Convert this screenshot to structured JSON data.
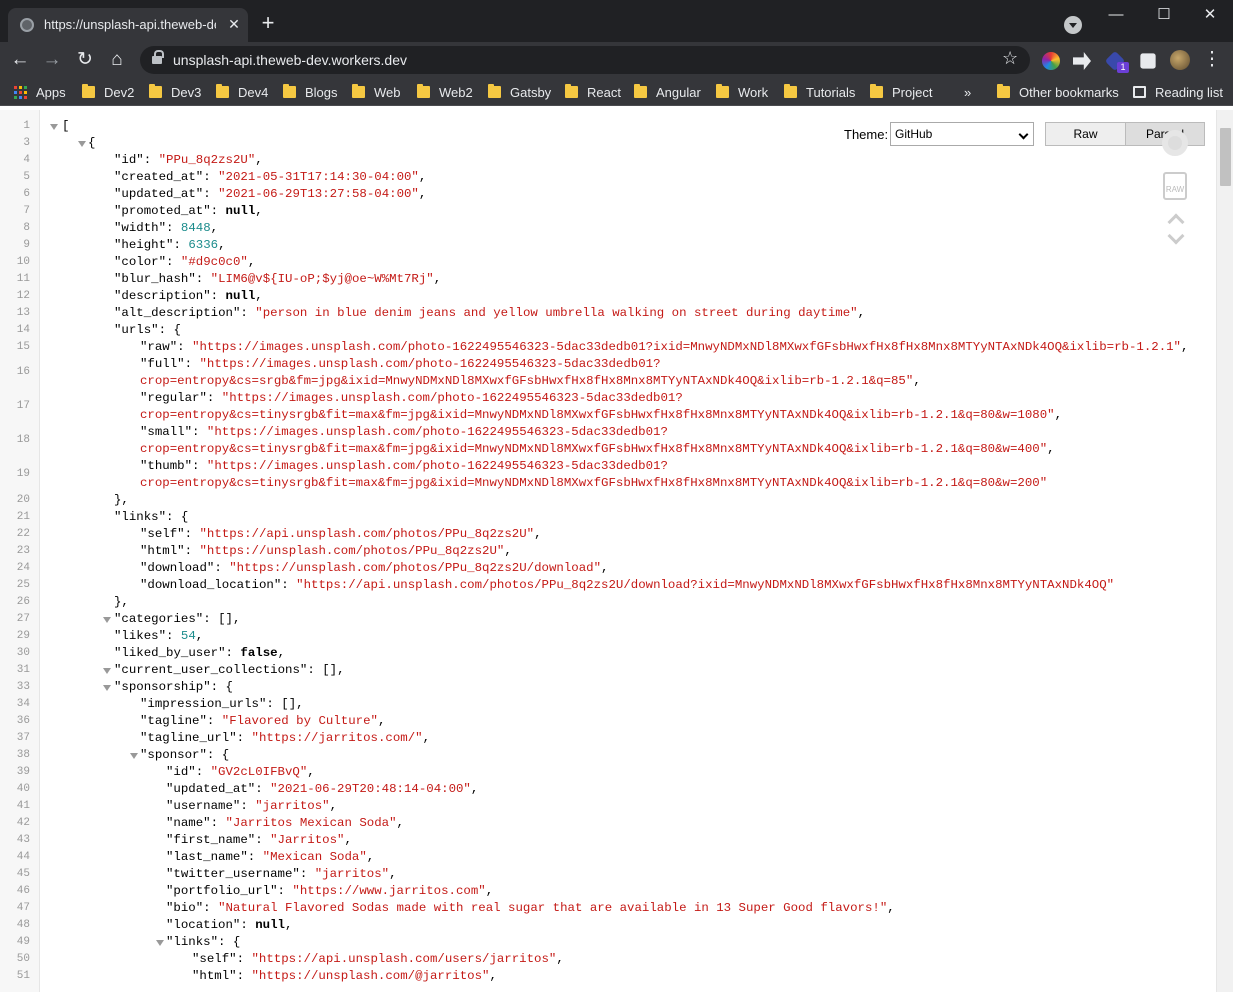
{
  "tab": {
    "title": "https://unsplash-api.theweb-dev.workers.dev",
    "close": "✕",
    "new_tab": "+"
  },
  "window": {
    "minimize": "—",
    "maximize": "☐",
    "close": "✕"
  },
  "toolbar": {
    "back": "←",
    "forward": "→",
    "reload": "↻",
    "home": "⌂",
    "star": "☆",
    "url": "unsplash-api.theweb-dev.workers.dev",
    "ext_badge": "1",
    "menu": "⋮"
  },
  "bookmarks": {
    "items": [
      "Apps",
      "Dev2",
      "Dev3",
      "Dev4",
      "Blogs",
      "Web",
      "Web2",
      "Gatsby",
      "React",
      "Angular",
      "Work",
      "Tutorials",
      "Project"
    ],
    "overflow": "»",
    "other": "Other bookmarks",
    "reading_list": "Reading list"
  },
  "viewer": {
    "theme_label": "Theme:",
    "theme_value": "GitHub",
    "raw_button": "Raw",
    "parsed_button": "Parsed",
    "raw_icon_label": "RAW"
  },
  "json_lines": [
    {
      "n": 1,
      "i": 0,
      "c": 1,
      "p": [
        [
          "k",
          "["
        ]
      ]
    },
    {
      "n": 3,
      "i": 1,
      "c": 1,
      "p": [
        [
          "k",
          "{"
        ]
      ]
    },
    {
      "n": 4,
      "i": 2,
      "p": [
        [
          "k",
          "\"id\": "
        ],
        [
          "s",
          "\"PPu_8q2zs2U\""
        ],
        [
          "k",
          ","
        ]
      ]
    },
    {
      "n": 5,
      "i": 2,
      "p": [
        [
          "k",
          "\"created_at\": "
        ],
        [
          "s",
          "\"2021-05-31T17:14:30-04:00\""
        ],
        [
          "k",
          ","
        ]
      ]
    },
    {
      "n": 6,
      "i": 2,
      "p": [
        [
          "k",
          "\"updated_at\": "
        ],
        [
          "s",
          "\"2021-06-29T13:27:58-04:00\""
        ],
        [
          "k",
          ","
        ]
      ]
    },
    {
      "n": 7,
      "i": 2,
      "p": [
        [
          "k",
          "\"promoted_at\": "
        ],
        [
          "b",
          "null"
        ],
        [
          "k",
          ","
        ]
      ]
    },
    {
      "n": 8,
      "i": 2,
      "p": [
        [
          "k",
          "\"width\": "
        ],
        [
          "n",
          "8448"
        ],
        [
          "k",
          ","
        ]
      ]
    },
    {
      "n": 9,
      "i": 2,
      "p": [
        [
          "k",
          "\"height\": "
        ],
        [
          "n",
          "6336"
        ],
        [
          "k",
          ","
        ]
      ]
    },
    {
      "n": 10,
      "i": 2,
      "p": [
        [
          "k",
          "\"color\": "
        ],
        [
          "s",
          "\"#d9c0c0\""
        ],
        [
          "k",
          ","
        ]
      ]
    },
    {
      "n": 11,
      "i": 2,
      "p": [
        [
          "k",
          "\"blur_hash\": "
        ],
        [
          "s",
          "\"LIM6@v${IU-oP;$yj@oe~W%Mt7Rj\""
        ],
        [
          "k",
          ","
        ]
      ]
    },
    {
      "n": 12,
      "i": 2,
      "p": [
        [
          "k",
          "\"description\": "
        ],
        [
          "b",
          "null"
        ],
        [
          "k",
          ","
        ]
      ]
    },
    {
      "n": 13,
      "i": 2,
      "p": [
        [
          "k",
          "\"alt_description\": "
        ],
        [
          "s",
          "\"person in blue denim jeans and yellow umbrella walking on street during daytime\""
        ],
        [
          "k",
          ","
        ]
      ]
    },
    {
      "n": 14,
      "i": 2,
      "p": [
        [
          "k",
          "\"urls\": {"
        ]
      ]
    },
    {
      "n": 15,
      "i": 3,
      "p": [
        [
          "k",
          "\"raw\": "
        ],
        [
          "s",
          "\"https://images.unsplash.com/photo-1622495546323-5dac33dedb01?ixid=MnwyNDMxNDl8MXwxfGFsbHwxfHx8fHx8Mnx8MTYyNTAxNDk4OQ&ixlib=rb-1.2.1\""
        ],
        [
          "k",
          ","
        ]
      ]
    },
    {
      "n": 16,
      "i": 3,
      "p": [
        [
          "k",
          "\"full\": "
        ],
        [
          "s",
          "\"https://images.unsplash.com/photo-1622495546323-5dac33dedb01?"
        ]
      ],
      "p2": [
        [
          "s",
          "crop=entropy&cs=srgb&fm=jpg&ixid=MnwyNDMxNDl8MXwxfGFsbHwxfHx8fHx8Mnx8MTYyNTAxNDk4OQ&ixlib=rb-1.2.1&q=85\""
        ],
        [
          "k",
          ","
        ]
      ]
    },
    {
      "n": 17,
      "i": 3,
      "p": [
        [
          "k",
          "\"regular\": "
        ],
        [
          "s",
          "\"https://images.unsplash.com/photo-1622495546323-5dac33dedb01?"
        ]
      ],
      "p2": [
        [
          "s",
          "crop=entropy&cs=tinysrgb&fit=max&fm=jpg&ixid=MnwyNDMxNDl8MXwxfGFsbHwxfHx8fHx8Mnx8MTYyNTAxNDk4OQ&ixlib=rb-1.2.1&q=80&w=1080\""
        ],
        [
          "k",
          ","
        ]
      ]
    },
    {
      "n": 18,
      "i": 3,
      "p": [
        [
          "k",
          "\"small\": "
        ],
        [
          "s",
          "\"https://images.unsplash.com/photo-1622495546323-5dac33dedb01?"
        ]
      ],
      "p2": [
        [
          "s",
          "crop=entropy&cs=tinysrgb&fit=max&fm=jpg&ixid=MnwyNDMxNDl8MXwxfGFsbHwxfHx8fHx8Mnx8MTYyNTAxNDk4OQ&ixlib=rb-1.2.1&q=80&w=400\""
        ],
        [
          "k",
          ","
        ]
      ]
    },
    {
      "n": 19,
      "i": 3,
      "p": [
        [
          "k",
          "\"thumb\": "
        ],
        [
          "s",
          "\"https://images.unsplash.com/photo-1622495546323-5dac33dedb01?"
        ]
      ],
      "p2": [
        [
          "s",
          "crop=entropy&cs=tinysrgb&fit=max&fm=jpg&ixid=MnwyNDMxNDl8MXwxfGFsbHwxfHx8fHx8Mnx8MTYyNTAxNDk4OQ&ixlib=rb-1.2.1&q=80&w=200\""
        ]
      ]
    },
    {
      "n": 20,
      "i": 2,
      "p": [
        [
          "k",
          "},"
        ]
      ]
    },
    {
      "n": 21,
      "i": 2,
      "p": [
        [
          "k",
          "\"links\": {"
        ]
      ]
    },
    {
      "n": 22,
      "i": 3,
      "p": [
        [
          "k",
          "\"self\": "
        ],
        [
          "s",
          "\"https://api.unsplash.com/photos/PPu_8q2zs2U\""
        ],
        [
          "k",
          ","
        ]
      ]
    },
    {
      "n": 23,
      "i": 3,
      "p": [
        [
          "k",
          "\"html\": "
        ],
        [
          "s",
          "\"https://unsplash.com/photos/PPu_8q2zs2U\""
        ],
        [
          "k",
          ","
        ]
      ]
    },
    {
      "n": 24,
      "i": 3,
      "p": [
        [
          "k",
          "\"download\": "
        ],
        [
          "s",
          "\"https://unsplash.com/photos/PPu_8q2zs2U/download\""
        ],
        [
          "k",
          ","
        ]
      ]
    },
    {
      "n": 25,
      "i": 3,
      "p": [
        [
          "k",
          "\"download_location\": "
        ],
        [
          "s",
          "\"https://api.unsplash.com/photos/PPu_8q2zs2U/download?ixid=MnwyNDMxNDl8MXwxfGFsbHwxfHx8fHx8Mnx8MTYyNTAxNDk4OQ\""
        ]
      ]
    },
    {
      "n": 26,
      "i": 2,
      "p": [
        [
          "k",
          "},"
        ]
      ]
    },
    {
      "n": 27,
      "i": 2,
      "c": 1,
      "p": [
        [
          "k",
          "\"categories\": [],"
        ]
      ]
    },
    {
      "n": 29,
      "i": 2,
      "p": [
        [
          "k",
          "\"likes\": "
        ],
        [
          "n",
          "54"
        ],
        [
          "k",
          ","
        ]
      ]
    },
    {
      "n": 30,
      "i": 2,
      "p": [
        [
          "k",
          "\"liked_by_user\": "
        ],
        [
          "b",
          "false"
        ],
        [
          "k",
          ","
        ]
      ]
    },
    {
      "n": 31,
      "i": 2,
      "c": 1,
      "p": [
        [
          "k",
          "\"current_user_collections\": [],"
        ]
      ]
    },
    {
      "n": 33,
      "i": 2,
      "c": 1,
      "p": [
        [
          "k",
          "\"sponsorship\": {"
        ]
      ]
    },
    {
      "n": 34,
      "i": 3,
      "p": [
        [
          "k",
          "\"impression_urls\": [],"
        ]
      ]
    },
    {
      "n": 36,
      "i": 3,
      "p": [
        [
          "k",
          "\"tagline\": "
        ],
        [
          "s",
          "\"Flavored by Culture\""
        ],
        [
          "k",
          ","
        ]
      ]
    },
    {
      "n": 37,
      "i": 3,
      "p": [
        [
          "k",
          "\"tagline_url\": "
        ],
        [
          "s",
          "\"https://jarritos.com/\""
        ],
        [
          "k",
          ","
        ]
      ]
    },
    {
      "n": 38,
      "i": 3,
      "c": 1,
      "p": [
        [
          "k",
          "\"sponsor\": {"
        ]
      ]
    },
    {
      "n": 39,
      "i": 4,
      "p": [
        [
          "k",
          "\"id\": "
        ],
        [
          "s",
          "\"GV2cL0IFBvQ\""
        ],
        [
          "k",
          ","
        ]
      ]
    },
    {
      "n": 40,
      "i": 4,
      "p": [
        [
          "k",
          "\"updated_at\": "
        ],
        [
          "s",
          "\"2021-06-29T20:48:14-04:00\""
        ],
        [
          "k",
          ","
        ]
      ]
    },
    {
      "n": 41,
      "i": 4,
      "p": [
        [
          "k",
          "\"username\": "
        ],
        [
          "s",
          "\"jarritos\""
        ],
        [
          "k",
          ","
        ]
      ]
    },
    {
      "n": 42,
      "i": 4,
      "p": [
        [
          "k",
          "\"name\": "
        ],
        [
          "s",
          "\"Jarritos Mexican Soda\""
        ],
        [
          "k",
          ","
        ]
      ]
    },
    {
      "n": 43,
      "i": 4,
      "p": [
        [
          "k",
          "\"first_name\": "
        ],
        [
          "s",
          "\"Jarritos\""
        ],
        [
          "k",
          ","
        ]
      ]
    },
    {
      "n": 44,
      "i": 4,
      "p": [
        [
          "k",
          "\"last_name\": "
        ],
        [
          "s",
          "\"Mexican Soda\""
        ],
        [
          "k",
          ","
        ]
      ]
    },
    {
      "n": 45,
      "i": 4,
      "p": [
        [
          "k",
          "\"twitter_username\": "
        ],
        [
          "s",
          "\"jarritos\""
        ],
        [
          "k",
          ","
        ]
      ]
    },
    {
      "n": 46,
      "i": 4,
      "p": [
        [
          "k",
          "\"portfolio_url\": "
        ],
        [
          "s",
          "\"https://www.jarritos.com\""
        ],
        [
          "k",
          ","
        ]
      ]
    },
    {
      "n": 47,
      "i": 4,
      "p": [
        [
          "k",
          "\"bio\": "
        ],
        [
          "s",
          "\"Natural Flavored Sodas made with real sugar that are available in 13 Super Good flavors!\""
        ],
        [
          "k",
          ","
        ]
      ]
    },
    {
      "n": 48,
      "i": 4,
      "p": [
        [
          "k",
          "\"location\": "
        ],
        [
          "b",
          "null"
        ],
        [
          "k",
          ","
        ]
      ]
    },
    {
      "n": 49,
      "i": 4,
      "c": 1,
      "p": [
        [
          "k",
          "\"links\": {"
        ]
      ]
    },
    {
      "n": 50,
      "i": 5,
      "p": [
        [
          "k",
          "\"self\": "
        ],
        [
          "s",
          "\"https://api.unsplash.com/users/jarritos\""
        ],
        [
          "k",
          ","
        ]
      ]
    },
    {
      "n": 51,
      "i": 5,
      "p": [
        [
          "k",
          "\"html\": "
        ],
        [
          "s",
          "\"https://unsplash.com/@jarritos\""
        ],
        [
          "k",
          ","
        ]
      ]
    }
  ],
  "colors": {
    "string": "#c41a16",
    "number": "#1c8c8c",
    "chrome_dark": "#202124",
    "chrome_toolbar": "#35363a",
    "folder": "#f5c842"
  }
}
